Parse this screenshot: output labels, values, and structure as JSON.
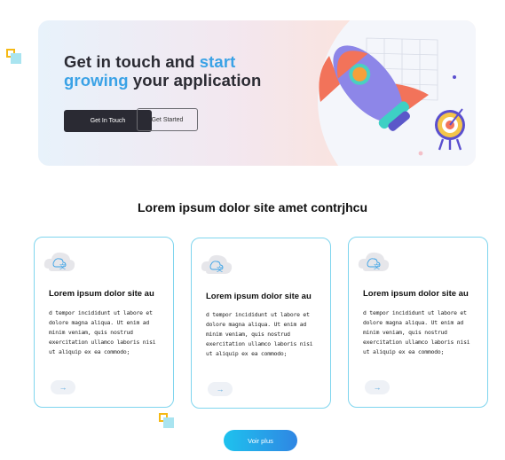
{
  "hero": {
    "title_part1": "Get in touch and ",
    "title_accent_1": "start",
    "title_accent_2": "growing",
    "title_part2": " your application",
    "cta_primary": "Get In Touch",
    "cta_secondary": "Get Started"
  },
  "section": {
    "title": "Lorem ipsum dolor site amet contrjhcu"
  },
  "cards": [
    {
      "icon": "cloud-translate-icon",
      "title": "Lorem ipsum dolor site au",
      "body": "d tempor incididunt ut labore et dolore magna aliqua. Ut enim ad minim veniam, quis nostrud exercitation ullamco laboris nisi ut aliquip ex ea commodo;",
      "arrow": "→"
    },
    {
      "icon": "cloud-translate-icon",
      "title": "Lorem ipsum dolor site au",
      "body": "d tempor incididunt ut labore et dolore magna aliqua. Ut enim ad minim veniam, quis nostrud exercitation ullamco laboris nisi ut aliquip ex ea commodo;",
      "arrow": "→"
    },
    {
      "icon": "cloud-translate-icon",
      "title": "Lorem ipsum dolor site au",
      "body": "d tempor incididunt ut labore et dolore magna aliqua. Ut enim ad minim veniam, quis nostrud exercitation ullamco laboris nisi ut aliquip ex ea commodo;",
      "arrow": "→"
    }
  ],
  "footer": {
    "more_button": "Voir plus"
  },
  "colors": {
    "accent": "#3aa2e6",
    "card_border": "#7fd5ee",
    "dark_button": "#2a2a33"
  }
}
